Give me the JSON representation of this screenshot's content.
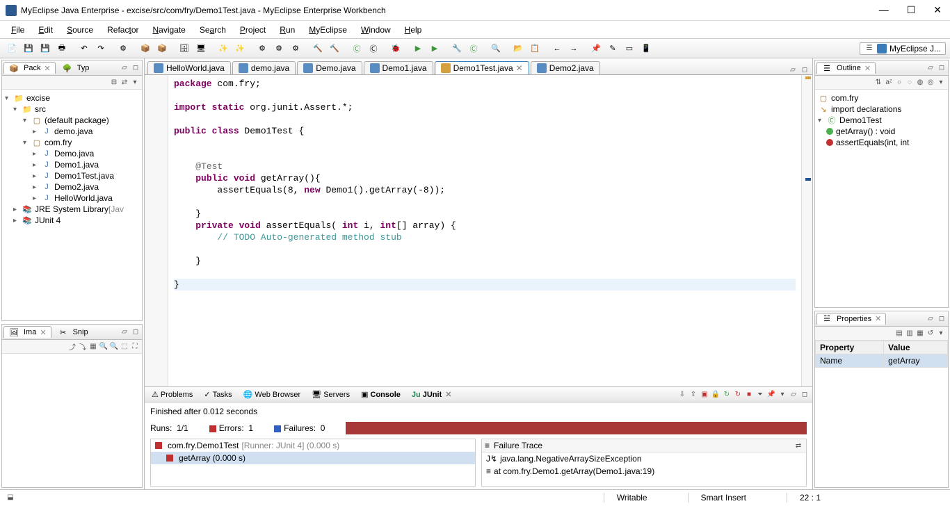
{
  "window": {
    "title": "MyEclipse Java Enterprise - excise/src/com/fry/Demo1Test.java - MyEclipse Enterprise Workbench"
  },
  "menu": {
    "items": [
      "File",
      "Edit",
      "Source",
      "Refactor",
      "Navigate",
      "Search",
      "Project",
      "Run",
      "MyEclipse",
      "Window",
      "Help"
    ]
  },
  "perspective": {
    "label": "MyEclipse J..."
  },
  "package_explorer": {
    "title": "Pack",
    "other_tab": "Typ",
    "nodes": {
      "project": "excise",
      "src": "src",
      "default_pkg": "(default package)",
      "demo_java": "demo.java",
      "com_fry": "com.fry",
      "files": [
        "Demo.java",
        "Demo1.java",
        "Demo1Test.java",
        "Demo2.java",
        "HelloWorld.java"
      ],
      "jre": "JRE System Library",
      "jre_suffix": "[Jav",
      "junit": "JUnit 4"
    }
  },
  "image_preview": {
    "title": "Ima",
    "other_tab": "Snip"
  },
  "editor": {
    "tabs": [
      "HelloWorld.java",
      "demo.java",
      "Demo.java",
      "Demo1.java",
      "Demo1Test.java",
      "Demo2.java"
    ],
    "active": 4,
    "code_lines": [
      {
        "pre": "",
        "kw": "package",
        "rest": " com.fry;"
      },
      {
        "pre": "",
        "raw": ""
      },
      {
        "pre": "",
        "kw": "import static",
        "rest": " org.junit.Assert.*;",
        "expand": true
      },
      {
        "pre": "",
        "raw": ""
      },
      {
        "pre": "",
        "kw": "public class",
        "rest": " Demo1Test {"
      },
      {
        "pre": "",
        "raw": ""
      },
      {
        "pre": "",
        "raw": ""
      },
      {
        "pre": "    ",
        "ann": "@Test"
      },
      {
        "pre": "    ",
        "kw": "public void",
        "rest": " getArray(){"
      },
      {
        "pre": "        ",
        "raw": "assertEquals(8,",
        "kw2": "new",
        "rest2": " Demo1().getArray(-8));"
      },
      {
        "pre": "",
        "raw": ""
      },
      {
        "pre": "    ",
        "raw": "}"
      },
      {
        "pre": "    ",
        "kw": "private void",
        "rest": " assertEquals(",
        "kw2": "int",
        "rest2": " i, ",
        "kw3": "int",
        "rest3": "[] array) {"
      },
      {
        "pre": "        ",
        "cmt": "// TODO Auto-generated method stub"
      },
      {
        "pre": "",
        "raw": ""
      },
      {
        "pre": "    ",
        "raw": "}"
      },
      {
        "pre": "",
        "raw": ""
      },
      {
        "pre": "",
        "raw": "}",
        "hl": true
      }
    ]
  },
  "bottom": {
    "tabs": [
      "Problems",
      "Tasks",
      "Web Browser",
      "Servers",
      "Console",
      "JUnit"
    ],
    "active": 5,
    "junit": {
      "finished": "Finished after 0.012 seconds",
      "runs_label": "Runs:",
      "runs": "1/1",
      "errors_label": "Errors:",
      "errors": "1",
      "failures_label": "Failures:",
      "failures": "0",
      "test_class": "com.fry.Demo1Test",
      "test_class_runner": "[Runner: JUnit 4] (0.000 s)",
      "test_method": "getArray (0.000 s)",
      "trace_header": "Failure Trace",
      "trace_lines": [
        "java.lang.NegativeArraySizeException",
        "at com.fry.Demo1.getArray(Demo1.java:19)"
      ]
    }
  },
  "outline": {
    "title": "Outline",
    "items": {
      "pkg": "com.fry",
      "imports": "import declarations",
      "cls": "Demo1Test",
      "m1": "getArray() : void",
      "m2": "assertEquals(int, int"
    }
  },
  "properties": {
    "title": "Properties",
    "col1": "Property",
    "col2": "Value",
    "row_prop": "Name",
    "row_val": "getArray"
  },
  "status": {
    "writable": "Writable",
    "insert": "Smart Insert",
    "pos": "22 : 1"
  }
}
